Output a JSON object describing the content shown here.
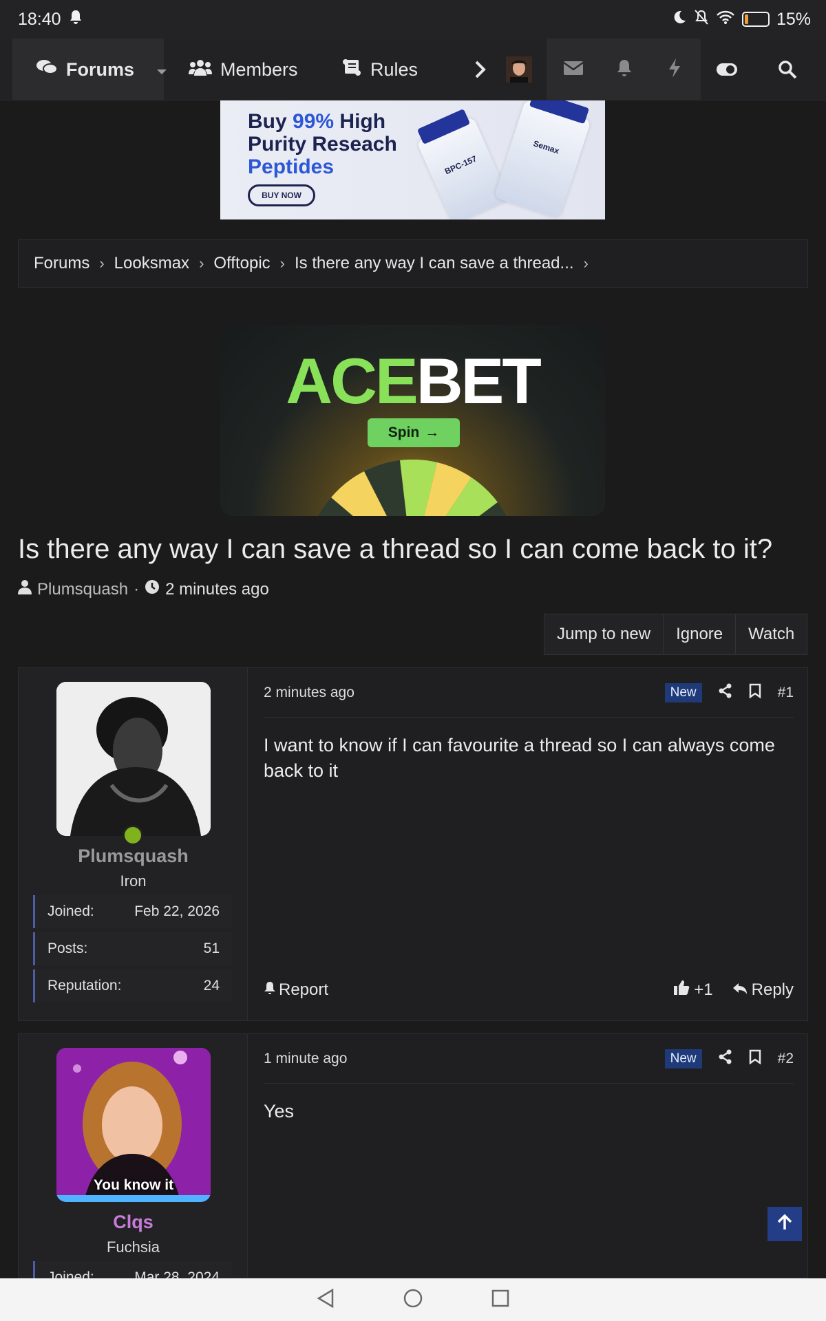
{
  "status": {
    "time": "18:40",
    "battery": "15%",
    "battery_level": 0.15
  },
  "nav": {
    "forums": "Forums",
    "members": "Members",
    "rules": "Rules"
  },
  "ad_peptides": {
    "line1_a": "Buy ",
    "line1_hl": "99%",
    "line1_b": " High",
    "line2": "Purity Reseach",
    "line3": "Peptides",
    "button": "BUY NOW",
    "vial1": "BPC-157",
    "vial2": "Semax"
  },
  "breadcrumb": [
    "Forums",
    "Looksmax",
    "Offtopic",
    "Is there any way I can save a thread..."
  ],
  "ad_acebet": {
    "logo_a": "ACE",
    "logo_b": "BET",
    "button": "Spin"
  },
  "thread": {
    "title": "Is there any way I can save a thread so I can come back to it?",
    "author": "Plumsquash",
    "time": "2 minutes ago"
  },
  "thread_actions": [
    "Jump to new",
    "Ignore",
    "Watch"
  ],
  "posts": [
    {
      "username": "Plumsquash",
      "user_color": "#9a9a9a",
      "rank": "Iron",
      "stats": [
        {
          "label": "Joined:",
          "value": "Feb 22, 2026"
        },
        {
          "label": "Posts:",
          "value": "51"
        },
        {
          "label": "Reputation:",
          "value": "24"
        }
      ],
      "time": "2 minutes ago",
      "badge": "New",
      "number": "#1",
      "body": "I want to know if I can favourite a thread so I can always come back to it",
      "report": "Report",
      "likes": "+1",
      "reply": "Reply"
    },
    {
      "username": "Clqs",
      "user_color": "#c77bd9",
      "rank": "Fuchsia",
      "avatar_caption": "You know it",
      "stats": [
        {
          "label": "Joined:",
          "value": "Mar 28, 2024"
        }
      ],
      "time": "1 minute ago",
      "badge": "New",
      "number": "#2",
      "body": "Yes"
    }
  ]
}
